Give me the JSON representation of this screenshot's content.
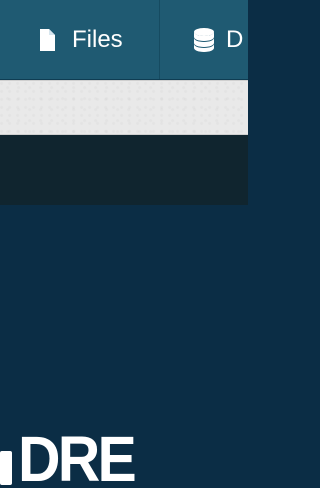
{
  "colors": {
    "nav_background": "#1f5a72",
    "light_bar": "#e9e9e9",
    "dark_strip": "#10252f",
    "main_background": "#0b2d45",
    "text": "#ffffff"
  },
  "nav": {
    "files": {
      "label": "Files",
      "icon": "file-icon"
    },
    "data": {
      "label": "D",
      "icon": "database-icon"
    }
  },
  "logo": {
    "text": "DRE"
  }
}
